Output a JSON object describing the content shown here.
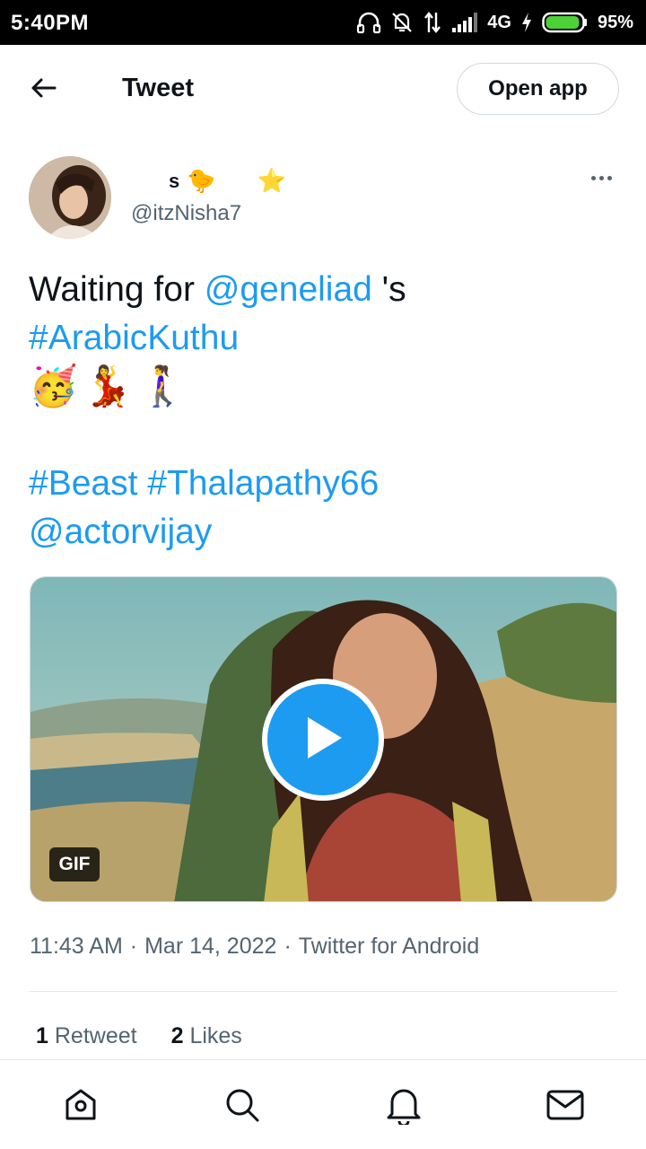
{
  "status_bar": {
    "time": "5:40PM",
    "network": "4G",
    "battery": "95%",
    "battery_level": 0.95,
    "icons": [
      "headphones-icon",
      "bell-off-icon",
      "data-transfer-icon",
      "signal-icon",
      "charging-icon",
      "battery-icon"
    ]
  },
  "header": {
    "title": "Tweet",
    "open_app_label": "Open app",
    "back_icon": "arrow-left-icon"
  },
  "author": {
    "name": "s",
    "name_emojis": [
      "🐤",
      "⭐"
    ],
    "handle": "@itzNisha7"
  },
  "tweet": {
    "text_prefix": "Waiting for ",
    "mention1": "@geneliad",
    "text_suffix": " 's",
    "hashtag1": "#ArabicKuthu",
    "emojis": "🥳💃🚶‍♀️",
    "hashtags_line": "#Beast #Thalapathy66",
    "mention2": "@actorvijay"
  },
  "media": {
    "badge": "GIF",
    "play_icon": "play-icon"
  },
  "meta": {
    "time": "11:43 AM",
    "separator": "·",
    "date": "Mar 14, 2022",
    "source": "Twitter for Android"
  },
  "stats": {
    "retweet_count": "1",
    "retweet_label": "Retweet",
    "likes_count": "2",
    "likes_label": "Likes"
  },
  "nav": [
    "home-icon",
    "search-icon",
    "notifications-icon",
    "messages-icon"
  ],
  "colors": {
    "accent": "#1d9bf0",
    "text": "#0f1419",
    "secondary": "#536471",
    "border": "#cfd9de"
  }
}
